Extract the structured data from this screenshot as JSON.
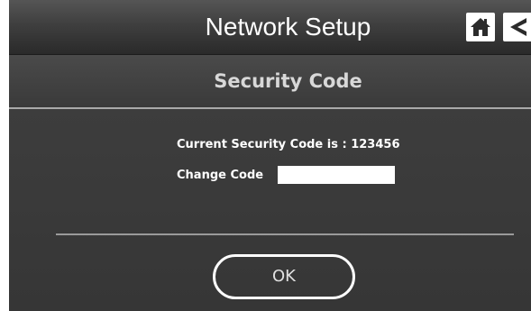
{
  "header": {
    "title": "Network Setup",
    "home_icon": "home-icon",
    "back_icon": "back-arrow-icon"
  },
  "section": {
    "title": "Security Code"
  },
  "form": {
    "current_code_text": "Current Security Code is : 123456",
    "change_code_label": "Change Code",
    "change_code_value": ""
  },
  "actions": {
    "ok_label": "OK"
  },
  "colors": {
    "background": "#3b3b3b",
    "text": "#ffffff",
    "divider": "#a9a9a9"
  }
}
